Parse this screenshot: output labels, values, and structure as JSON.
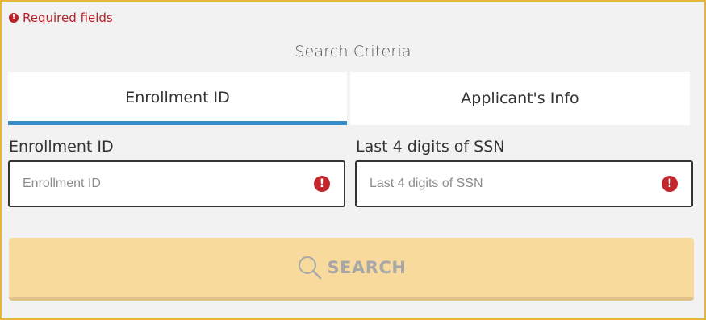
{
  "required_notice": {
    "icon": "alert-circle-icon",
    "text": "Required fields",
    "color": "#b7222b"
  },
  "section": {
    "title": "Search Criteria"
  },
  "tabs": [
    {
      "label": "Enrollment ID",
      "active": true
    },
    {
      "label": "Applicant's Info",
      "active": false
    }
  ],
  "fields": {
    "enrollment": {
      "label": "Enrollment ID",
      "placeholder": "Enrollment ID",
      "value": "",
      "icon": "alert-circle-icon"
    },
    "ssn": {
      "label": "Last 4 digits of SSN",
      "placeholder": "Last 4 digits of SSN",
      "value": "",
      "icon": "alert-circle-icon"
    }
  },
  "search_button": {
    "label": "SEARCH",
    "icon": "search-icon",
    "disabled": true
  },
  "colors": {
    "accent_tab": "#3b8bc6",
    "button_bg": "#f7da9c",
    "error": "#c1272d",
    "frame_border": "#e7b53b"
  }
}
